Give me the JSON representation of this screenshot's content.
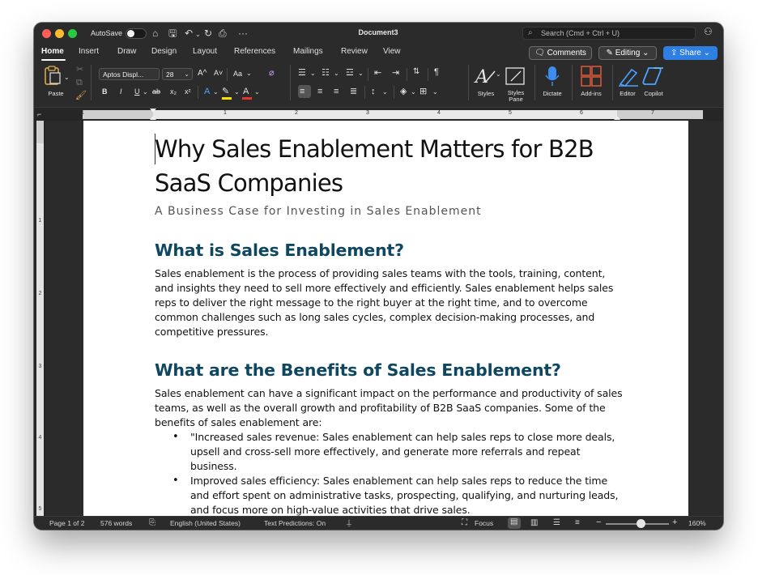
{
  "titlebar": {
    "autosave_label": "AutoSave",
    "document_title": "Document3",
    "search_placeholder": "Search (Cmd + Ctrl + U)",
    "more_label": "···"
  },
  "tabs": [
    {
      "label": "Home",
      "active": true
    },
    {
      "label": "Insert"
    },
    {
      "label": "Draw"
    },
    {
      "label": "Design"
    },
    {
      "label": "Layout"
    },
    {
      "label": "References"
    },
    {
      "label": "Mailings"
    },
    {
      "label": "Review"
    },
    {
      "label": "View"
    }
  ],
  "actions": {
    "comments": "Comments",
    "editing": "Editing",
    "share": "Share"
  },
  "ribbon": {
    "paste": "Paste",
    "font_name": "Aptos Displ...",
    "font_size": "28",
    "grow_font": "A^",
    "shrink_font": "A˅",
    "change_case": "Aa",
    "bold": "B",
    "italic": "I",
    "underline": "U",
    "strikethrough": "ab",
    "subscript": "x₂",
    "superscript": "x²",
    "styles": "Styles",
    "styles_pane": "Styles Pane",
    "dictate": "Dictate",
    "addins": "Add-ins",
    "editor": "Editor",
    "copilot": "Copilot"
  },
  "ruler_numbers": [
    "1",
    "1",
    "2",
    "3",
    "4",
    "5",
    "6",
    "7"
  ],
  "vruler_numbers": [
    "1",
    "2",
    "3",
    "4",
    "5"
  ],
  "document": {
    "title": "Why Sales Enablement Matters for B2B SaaS Companies",
    "subtitle": "A Business Case for Investing in Sales Enablement",
    "h2_1": "What is Sales Enablement?",
    "p1": "Sales enablement is the process of providing sales teams with the tools, training, content, and insights they need to sell more effectively and efficiently. Sales enablement helps sales reps to deliver the right message to the right buyer at the right time, and to overcome common challenges such as long sales cycles, complex decision-making processes, and competitive pressures.",
    "h2_2": "What are the Benefits of Sales Enablement?",
    "p2": "Sales enablement can have a significant impact on the performance and productivity of sales teams, as well as the overall growth and profitability of B2B SaaS companies. Some of the benefits of sales enablement are:",
    "bullets": [
      "\"Increased sales revenue: Sales enablement can help sales reps to close more deals, upsell and cross-sell more effectively, and generate more referrals and repeat business.",
      "Improved sales efficiency: Sales enablement can help sales reps to reduce the time and effort spent on administrative tasks, prospecting, qualifying, and nurturing leads, and focus more on high-value activities that drive sales."
    ]
  },
  "status": {
    "page": "Page 1 of 2",
    "words": "576 words",
    "language": "English (United States)",
    "predictions": "Text Predictions: On",
    "focus": "Focus",
    "zoom": "160%",
    "zoom_minus": "−",
    "zoom_plus": "+"
  },
  "colors": {
    "heading": "#0f4761",
    "share": "#2f7fe3",
    "window_bg": "#2b2b2b"
  },
  "zoom_level_percent": 160
}
